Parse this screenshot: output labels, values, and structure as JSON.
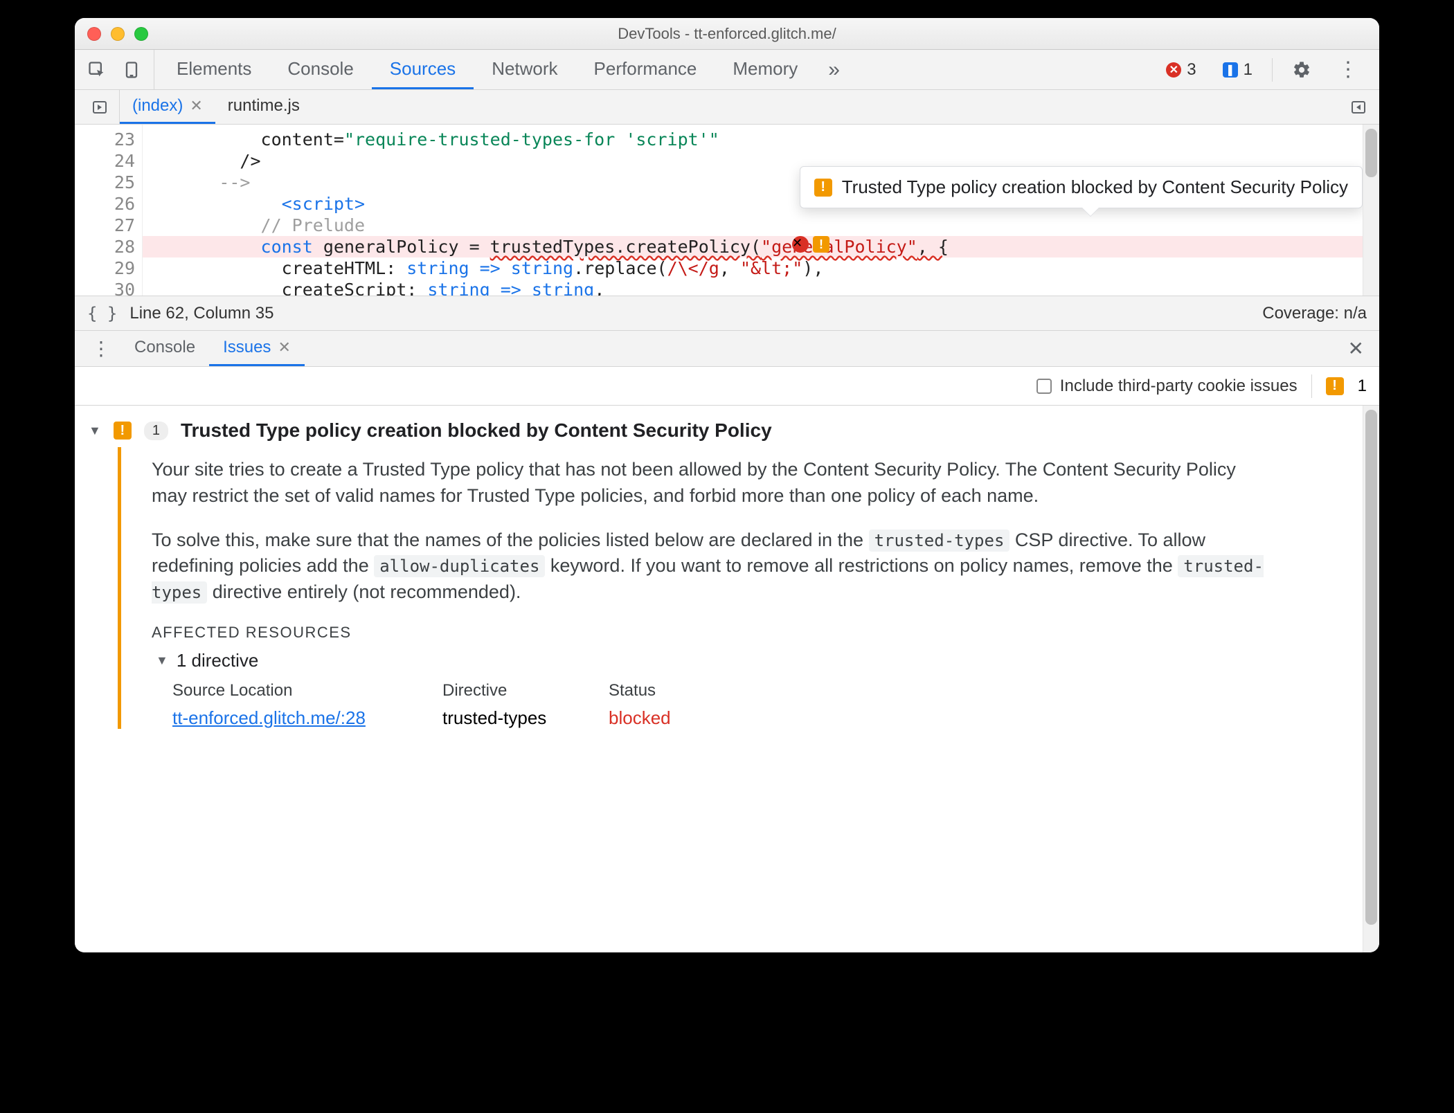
{
  "window": {
    "title": "DevTools - tt-enforced.glitch.me/"
  },
  "mainTabs": {
    "items": [
      "Elements",
      "Console",
      "Sources",
      "Network",
      "Performance",
      "Memory"
    ],
    "activeIndex": 2,
    "overflow": "»"
  },
  "statusChips": {
    "errors": "3",
    "messages": "1"
  },
  "fileTabs": {
    "items": [
      {
        "label": "(index)",
        "closable": true
      },
      {
        "label": "runtime.js",
        "closable": false
      }
    ],
    "activeIndex": 0
  },
  "source": {
    "lineStart": 23,
    "lines": [
      {
        "n": "23",
        "html": "          <span class='c-txt'>content=</span><span class='c-green'>\"require-trusted-types-for 'script'\"</span>"
      },
      {
        "n": "24",
        "html": "        <span class='c-txt'>/&gt;</span>"
      },
      {
        "n": "25",
        "html": "      <span class='c-comment'>--&gt;</span>"
      },
      {
        "n": "26",
        "html": "            <span class='c-tag'>&lt;script&gt;</span>"
      },
      {
        "n": "27",
        "html": "          <span class='c-comment'>// Prelude</span>"
      },
      {
        "n": "28",
        "html": "          <span class='c-kw'>const</span> <span class='c-txt'>generalPolicy</span> = <span class='c-txt squiggle'>trustedTypes.createPolicy(</span><span class='c-str squiggle'>\"generalPolicy\"</span><span class='c-txt squiggle'>, {</span>",
        "highlight": true
      },
      {
        "n": "29",
        "html": "            <span class='c-txt'>createHTML: </span><span class='c-type'>string</span> <span class='c-kw'>=&gt;</span> <span class='c-type'>string</span><span class='c-txt'>.replace(</span><span class='c-str'>/\\&lt;/g</span><span class='c-txt'>, </span><span class='c-str'>\"&amp;lt;\"</span><span class='c-txt'>),</span>"
      },
      {
        "n": "30",
        "html": "            <span class='c-txt'>createScript: </span><span class='c-type'>string</span> <span class='c-kw'>=&gt;</span> <span class='c-type'>string</span><span class='c-txt'>,</span>"
      }
    ],
    "tooltip": "Trusted Type policy creation blocked by Content Security Policy"
  },
  "sourceStatus": {
    "cursor": "Line 62, Column 35",
    "coverage": "Coverage: n/a"
  },
  "drawer": {
    "tabs": [
      "Console",
      "Issues"
    ],
    "activeIndex": 1,
    "filterCheckboxLabel": "Include third-party cookie issues",
    "warnCount": "1"
  },
  "issue": {
    "count": "1",
    "title": "Trusted Type policy creation blocked by Content Security Policy",
    "para1_a": "Your site tries to create a Trusted Type policy that has not been allowed by the Content Security Policy. The Content Security Policy may restrict the set of valid names for Trusted Type policies, and forbid more than one policy of each name.",
    "para2_a": "To solve this, make sure that the names of the policies listed below are declared in the ",
    "para2_code1": "trusted-types",
    "para2_b": " CSP directive. To allow redefining policies add the ",
    "para2_code2": "allow-duplicates",
    "para2_c": " keyword. If you want to remove all restrictions on policy names, remove the ",
    "para2_code3": "trusted-types",
    "para2_d": " directive entirely (not recommended).",
    "affectedHeader": "AFFECTED RESOURCES",
    "directiveSummary": "1 directive",
    "table": {
      "headers": {
        "sourceLocation": "Source Location",
        "directive": "Directive",
        "status": "Status"
      },
      "row": {
        "sourceLocation": "tt-enforced.glitch.me/:28",
        "directive": "trusted-types",
        "status": "blocked"
      }
    }
  }
}
